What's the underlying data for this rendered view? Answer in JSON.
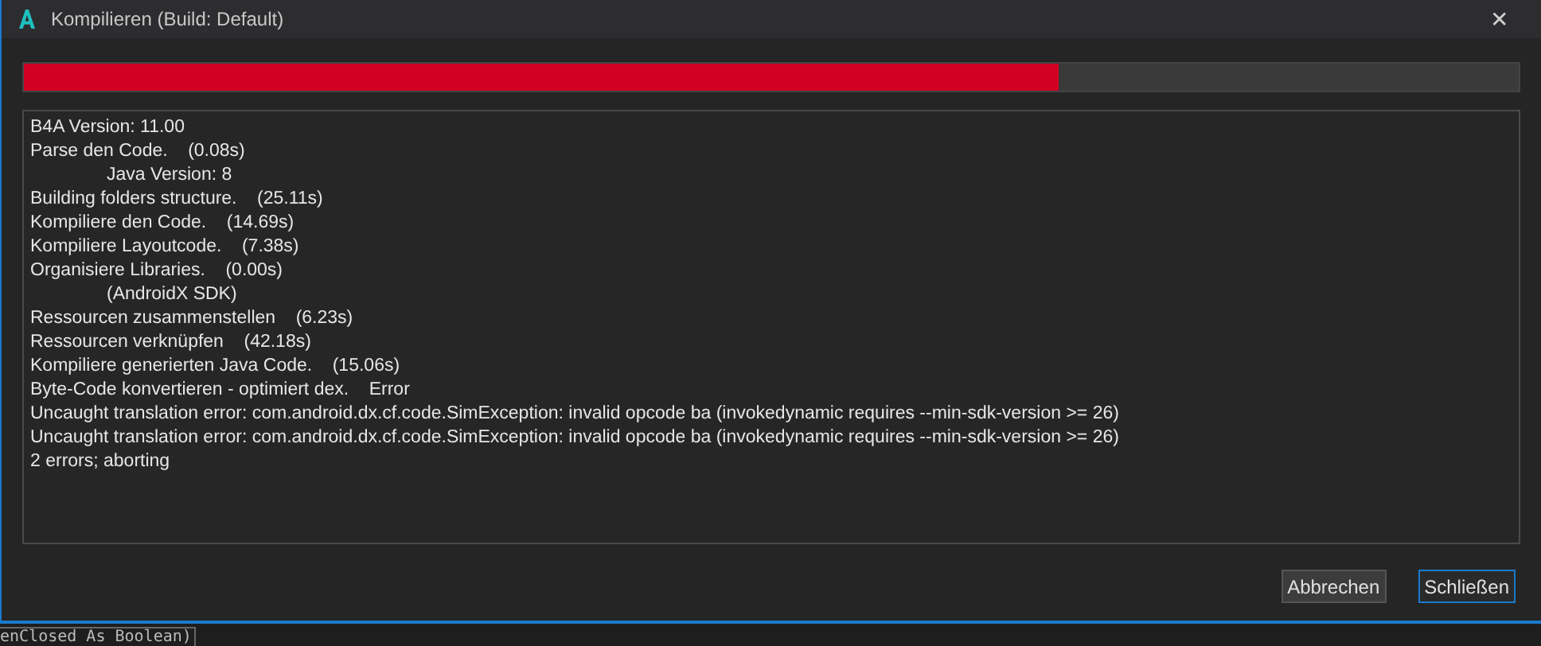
{
  "window": {
    "title": "Kompilieren (Build: Default)",
    "close_glyph": "✕"
  },
  "progress": {
    "level": 0.692
  },
  "log": [
    {
      "kind": "line",
      "text": "B4A Version: 11.00"
    },
    {
      "kind": "line",
      "text": "Parse den Code.    (0.08s)"
    },
    {
      "kind": "indented",
      "text": "Java Version: 8"
    },
    {
      "kind": "line",
      "text": "Building folders structure.    (25.11s)"
    },
    {
      "kind": "line",
      "text": "Kompiliere den Code.    (14.69s)"
    },
    {
      "kind": "line",
      "text": "Kompiliere Layoutcode.    (7.38s)"
    },
    {
      "kind": "line",
      "text": "Organisiere Libraries.    (0.00s)"
    },
    {
      "kind": "indented",
      "text": "(AndroidX SDK)"
    },
    {
      "kind": "line",
      "text": "Ressourcen zusammenstellen    (6.23s)"
    },
    {
      "kind": "line",
      "text": "Ressourcen verknüpfen    (42.18s)"
    },
    {
      "kind": "line",
      "text": "Kompiliere generierten Java Code.    (15.06s)"
    },
    {
      "kind": "line",
      "text": "Byte-Code konvertieren - optimiert dex.    Error"
    },
    {
      "kind": "line",
      "text": "Uncaught translation error: com.android.dx.cf.code.SimException: invalid opcode ba (invokedynamic requires --min-sdk-version >= 26)"
    },
    {
      "kind": "line",
      "text": "Uncaught translation error: com.android.dx.cf.code.SimException: invalid opcode ba (invokedynamic requires --min-sdk-version >= 26)"
    },
    {
      "kind": "line",
      "text": "2 errors; aborting"
    }
  ],
  "buttons": [
    {
      "label": "Abbrechen",
      "default": false
    },
    {
      "label": "Schließen",
      "default": true
    }
  ],
  "background_code": "enClosed As Boolean)"
}
